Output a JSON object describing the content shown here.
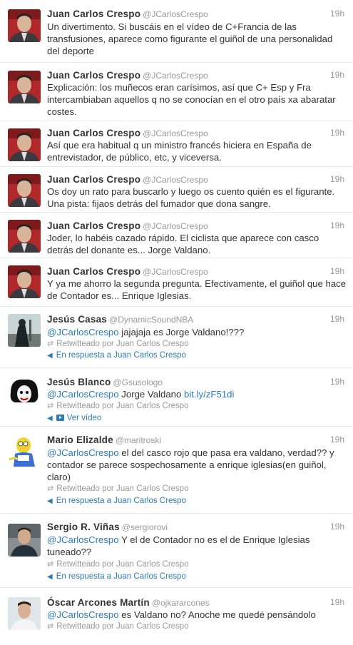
{
  "tweets": [
    {
      "name": "Juan Carlos Crespo",
      "handle": "@JCarlosCrespo",
      "time": "19h",
      "text": "Un divertimento. Si buscáis en el vídeo de C+Francia de las transfusiones, aparece como figurante el guiñol de una personalidad del deporte"
    },
    {
      "name": "Juan Carlos Crespo",
      "handle": "@JCarlosCrespo",
      "time": "19h",
      "text": "Explicación: los muñecos eran carísimos, así que C+ Esp y Fra intercambiaban aquellos q no se conocían en el otro país xa abaratar costes."
    },
    {
      "name": "Juan Carlos Crespo",
      "handle": "@JCarlosCrespo",
      "time": "19h",
      "text": "Así que era habitual q un ministro francés hiciera en España de entrevistador, de público, etc, y viceversa."
    },
    {
      "name": "Juan Carlos Crespo",
      "handle": "@JCarlosCrespo",
      "time": "19h",
      "text": "Os doy un rato para buscarlo y luego os cuento quién es el figurante. Una pista: fijaos detrás del fumador que dona sangre."
    },
    {
      "name": "Juan Carlos Crespo",
      "handle": "@JCarlosCrespo",
      "time": "19h",
      "text": "Joder, lo habéis cazado rápido. El ciclista que aparece con casco detrás del donante es... Jorge Valdano."
    },
    {
      "name": "Juan Carlos Crespo",
      "handle": "@JCarlosCrespo",
      "time": "19h",
      "text": "Y ya me ahorro la segunda pregunta. Efectivamente, el guiñol que hace de Contador es... Enrique Iglesias."
    },
    {
      "name": "Jesús Casas",
      "handle": "@DynamicSoundNBA",
      "time": "19h",
      "mention": "@JCarlosCrespo",
      "text": " jajajaja es Jorge Valdano!???",
      "retweet": "Retwitteado por Juan Carlos Crespo",
      "action": "En respuesta a Juan Carlos Crespo"
    },
    {
      "name": "Jesús Blanco",
      "handle": "@Gsusologo",
      "time": "19h",
      "mention": "@JCarlosCrespo",
      "text": " Jorge Valdano ",
      "link": "bit.ly/zF51di",
      "retweet": "Retwitteado por Juan Carlos Crespo",
      "action": "Ver vídeo"
    },
    {
      "name": "Mario Elizalde",
      "handle": "@maritroski",
      "time": "19h",
      "mention": "@JCarlosCrespo",
      "text": " el del casco rojo que pasa era valdano, verdad?? y contador se parece sospechosamente a enrique iglesias(en guiñol, claro)",
      "retweet": "Retwitteado por Juan Carlos Crespo",
      "action": "En respuesta a Juan Carlos Crespo"
    },
    {
      "name": "Sergio R. Viñas",
      "handle": "@sergiorovi",
      "time": "19h",
      "mention": "@JCarlosCrespo",
      "text": " Y el de Contador no es el de Enrique Iglesias tuneado??",
      "retweet": "Retwitteado por Juan Carlos Crespo",
      "action": "En respuesta a Juan Carlos Crespo"
    },
    {
      "name": "Óscar Arcones Martín",
      "handle": "@ojkararcones",
      "time": "19h",
      "mention": "@JCarlosCrespo",
      "text": " es Valdano no? Anoche me quedé pensándolo",
      "retweet": "Retwitteado por Juan Carlos Crespo"
    }
  ],
  "icons": {
    "retweet": "retweet-icon",
    "reply": "reply-icon",
    "video": "video-icon"
  },
  "colors": {
    "link": "#2b7bb9",
    "muted": "#999999",
    "text": "#333333"
  }
}
